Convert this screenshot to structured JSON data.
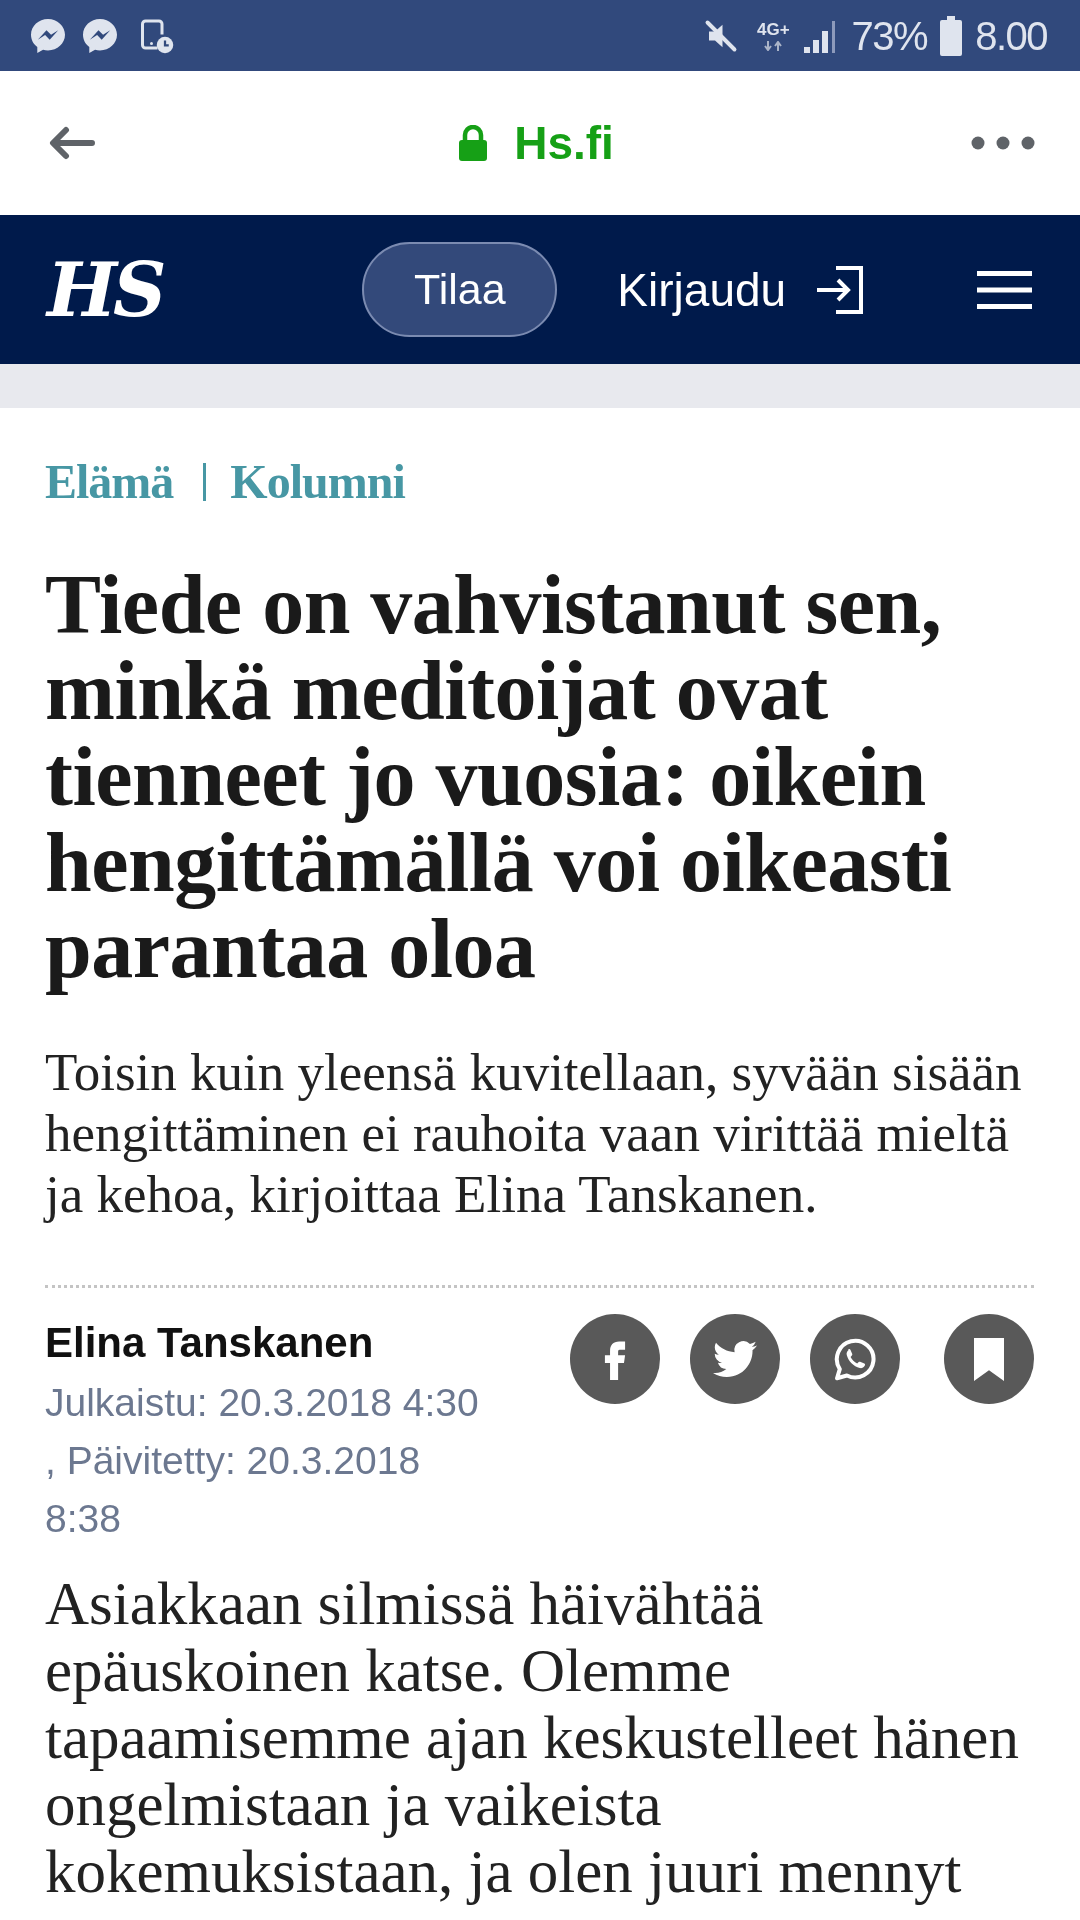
{
  "status_bar": {
    "network": "4G+",
    "battery": "73%",
    "time": "8.00"
  },
  "browser_bar": {
    "url": "Hs.fi"
  },
  "site_header": {
    "logo": "HS",
    "subscribe_button": "Tilaa",
    "login_link": "Kirjaudu"
  },
  "article": {
    "categories": [
      "Elämä",
      "Kolumni"
    ],
    "headline": "Tiede on vahvistanut sen, minkä meditoijat ovat tienneet jo vuosia: oikein hengittämällä voi oikeasti parantaa oloa",
    "lead": "Toisin kuin yleensä kuvitellaan, syvään sisään hengittäminen ei rauhoita vaan virittää mieltä ja kehoa, kirjoittaa Elina Tanskanen.",
    "author": "Elina Tanskanen",
    "published": "Julkaistu: 20.3.2018 4:30",
    "updated": ", Päivitetty: 20.3.2018 8:38",
    "body": "Asiakkaan silmissä häivähtää epäuskoinen katse. Olemme tapaamisemme ajan keskustelleet hänen ongelmistaan ja vaikeista kokemuksistaan, ja olen juuri mennyt"
  }
}
